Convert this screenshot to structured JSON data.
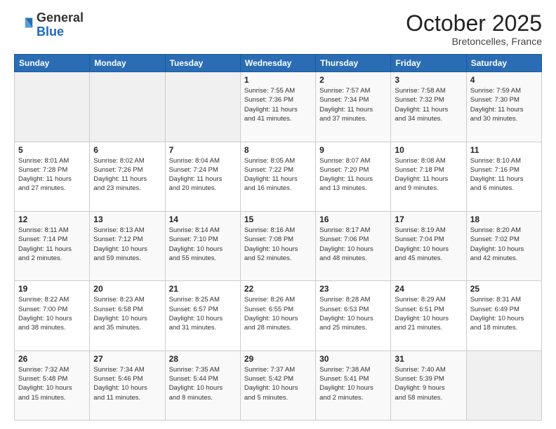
{
  "header": {
    "logo_general": "General",
    "logo_blue": "Blue",
    "month": "October 2025",
    "location": "Bretoncelles, France"
  },
  "days_of_week": [
    "Sunday",
    "Monday",
    "Tuesday",
    "Wednesday",
    "Thursday",
    "Friday",
    "Saturday"
  ],
  "weeks": [
    [
      {
        "day": "",
        "info": ""
      },
      {
        "day": "",
        "info": ""
      },
      {
        "day": "",
        "info": ""
      },
      {
        "day": "1",
        "info": "Sunrise: 7:55 AM\nSunset: 7:36 PM\nDaylight: 11 hours\nand 41 minutes."
      },
      {
        "day": "2",
        "info": "Sunrise: 7:57 AM\nSunset: 7:34 PM\nDaylight: 11 hours\nand 37 minutes."
      },
      {
        "day": "3",
        "info": "Sunrise: 7:58 AM\nSunset: 7:32 PM\nDaylight: 11 hours\nand 34 minutes."
      },
      {
        "day": "4",
        "info": "Sunrise: 7:59 AM\nSunset: 7:30 PM\nDaylight: 11 hours\nand 30 minutes."
      }
    ],
    [
      {
        "day": "5",
        "info": "Sunrise: 8:01 AM\nSunset: 7:28 PM\nDaylight: 11 hours\nand 27 minutes."
      },
      {
        "day": "6",
        "info": "Sunrise: 8:02 AM\nSunset: 7:26 PM\nDaylight: 11 hours\nand 23 minutes."
      },
      {
        "day": "7",
        "info": "Sunrise: 8:04 AM\nSunset: 7:24 PM\nDaylight: 11 hours\nand 20 minutes."
      },
      {
        "day": "8",
        "info": "Sunrise: 8:05 AM\nSunset: 7:22 PM\nDaylight: 11 hours\nand 16 minutes."
      },
      {
        "day": "9",
        "info": "Sunrise: 8:07 AM\nSunset: 7:20 PM\nDaylight: 11 hours\nand 13 minutes."
      },
      {
        "day": "10",
        "info": "Sunrise: 8:08 AM\nSunset: 7:18 PM\nDaylight: 11 hours\nand 9 minutes."
      },
      {
        "day": "11",
        "info": "Sunrise: 8:10 AM\nSunset: 7:16 PM\nDaylight: 11 hours\nand 6 minutes."
      }
    ],
    [
      {
        "day": "12",
        "info": "Sunrise: 8:11 AM\nSunset: 7:14 PM\nDaylight: 11 hours\nand 2 minutes."
      },
      {
        "day": "13",
        "info": "Sunrise: 8:13 AM\nSunset: 7:12 PM\nDaylight: 10 hours\nand 59 minutes."
      },
      {
        "day": "14",
        "info": "Sunrise: 8:14 AM\nSunset: 7:10 PM\nDaylight: 10 hours\nand 55 minutes."
      },
      {
        "day": "15",
        "info": "Sunrise: 8:16 AM\nSunset: 7:08 PM\nDaylight: 10 hours\nand 52 minutes."
      },
      {
        "day": "16",
        "info": "Sunrise: 8:17 AM\nSunset: 7:06 PM\nDaylight: 10 hours\nand 48 minutes."
      },
      {
        "day": "17",
        "info": "Sunrise: 8:19 AM\nSunset: 7:04 PM\nDaylight: 10 hours\nand 45 minutes."
      },
      {
        "day": "18",
        "info": "Sunrise: 8:20 AM\nSunset: 7:02 PM\nDaylight: 10 hours\nand 42 minutes."
      }
    ],
    [
      {
        "day": "19",
        "info": "Sunrise: 8:22 AM\nSunset: 7:00 PM\nDaylight: 10 hours\nand 38 minutes."
      },
      {
        "day": "20",
        "info": "Sunrise: 8:23 AM\nSunset: 6:58 PM\nDaylight: 10 hours\nand 35 minutes."
      },
      {
        "day": "21",
        "info": "Sunrise: 8:25 AM\nSunset: 6:57 PM\nDaylight: 10 hours\nand 31 minutes."
      },
      {
        "day": "22",
        "info": "Sunrise: 8:26 AM\nSunset: 6:55 PM\nDaylight: 10 hours\nand 28 minutes."
      },
      {
        "day": "23",
        "info": "Sunrise: 8:28 AM\nSunset: 6:53 PM\nDaylight: 10 hours\nand 25 minutes."
      },
      {
        "day": "24",
        "info": "Sunrise: 8:29 AM\nSunset: 6:51 PM\nDaylight: 10 hours\nand 21 minutes."
      },
      {
        "day": "25",
        "info": "Sunrise: 8:31 AM\nSunset: 6:49 PM\nDaylight: 10 hours\nand 18 minutes."
      }
    ],
    [
      {
        "day": "26",
        "info": "Sunrise: 7:32 AM\nSunset: 5:48 PM\nDaylight: 10 hours\nand 15 minutes."
      },
      {
        "day": "27",
        "info": "Sunrise: 7:34 AM\nSunset: 5:46 PM\nDaylight: 10 hours\nand 11 minutes."
      },
      {
        "day": "28",
        "info": "Sunrise: 7:35 AM\nSunset: 5:44 PM\nDaylight: 10 hours\nand 8 minutes."
      },
      {
        "day": "29",
        "info": "Sunrise: 7:37 AM\nSunset: 5:42 PM\nDaylight: 10 hours\nand 5 minutes."
      },
      {
        "day": "30",
        "info": "Sunrise: 7:38 AM\nSunset: 5:41 PM\nDaylight: 10 hours\nand 2 minutes."
      },
      {
        "day": "31",
        "info": "Sunrise: 7:40 AM\nSunset: 5:39 PM\nDaylight: 9 hours\nand 58 minutes."
      },
      {
        "day": "",
        "info": ""
      }
    ]
  ]
}
